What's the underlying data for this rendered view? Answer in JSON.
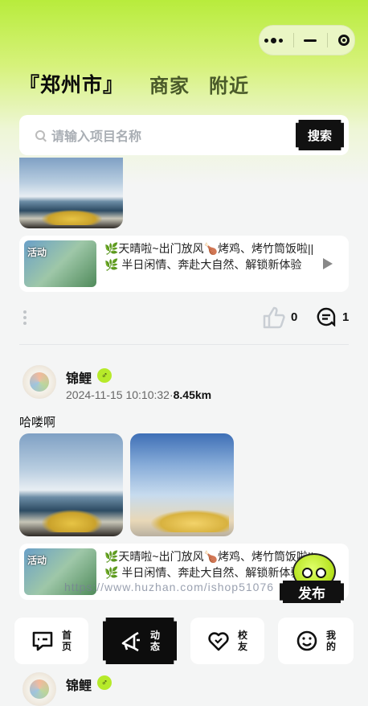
{
  "header": {
    "tabs": [
      {
        "label": "『郑州市』",
        "active": true
      },
      {
        "label": "商家",
        "active": false
      },
      {
        "label": "附近",
        "active": false
      }
    ]
  },
  "capsule": {
    "icons": [
      "more-dots-icon",
      "minimize-icon",
      "close-target-icon"
    ]
  },
  "search": {
    "placeholder": "请输入项目名称",
    "button_label": "搜索"
  },
  "posts": [
    {
      "activity": {
        "badge": "活动",
        "text": "🌿天晴啦~出门放风🍗烤鸡、烤竹筒饭啦||🌿 半日闲情、奔赴大自然、解锁新体验"
      },
      "likes": "0",
      "comments": "1"
    },
    {
      "user": "锦鲤",
      "gender": "♂",
      "time": "2024-11-15 10:10:32·",
      "distance": "8.45km",
      "text": "哈喽啊",
      "activity": {
        "badge": "活动",
        "text": "🌿天晴啦~出门放风🍗烤鸡、烤竹筒饭啦||🌿 半日闲情、奔赴大自然、解锁新体验"
      }
    },
    {
      "user": "锦鲤",
      "gender": "♂"
    }
  ],
  "watermark": "https://www.huzhan.com/ishop51076",
  "fab_label": "发布",
  "tabbar": [
    {
      "label": "首页",
      "icon": "home-chat-icon",
      "active": false
    },
    {
      "label": "动态",
      "icon": "megaphone-icon",
      "active": true
    },
    {
      "label": "校友",
      "icon": "heart-icon",
      "active": false
    },
    {
      "label": "我的",
      "icon": "smile-icon",
      "active": false
    }
  ],
  "colors": {
    "accent": "#b6ea2a",
    "dark": "#111111"
  }
}
